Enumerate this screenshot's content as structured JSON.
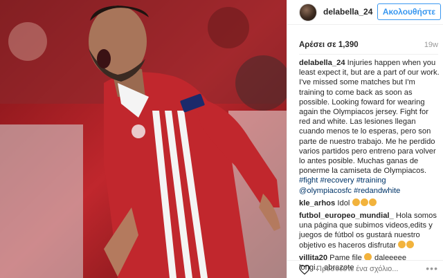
{
  "header": {
    "username": "delabella_24",
    "follow_label": "Ακολουθήστε"
  },
  "likes": "Αρέσει σε 1,390",
  "time": "19w",
  "caption": {
    "user": "delabella_24",
    "text": "Injuries happen when you least expect it, but are a part of our work. I've missed some matches but I'm training to come back as soon as possible. Looking foward for wearing again the Olympiacos jersey. Fight for red and white. Las lesiones llegan cuando menos te lo esperas, pero son parte de nuestro trabajo. Me he perdido varios partidos pero entreno para volver lo antes posible. Muchas ganas de ponerme la camiseta de Olympiacos.",
    "hashtags": "#fight #recovery #training",
    "mentions": "@olympiacosfc #redandwhite"
  },
  "comments": [
    {
      "user": "kle_arhos",
      "text": "Idol"
    },
    {
      "user": "futbol_europeo_mundial_",
      "text": "Hola somos una página que subimos videos,edits y juegos de fútbol os gustará nuestro objetivo es haceros disfrutar"
    },
    {
      "user": "villita20",
      "text": "Pame file",
      "text2": "daleeeee longi....abrazote"
    }
  ],
  "comment_placeholder": "Προσθέστε ένα σχόλιο...",
  "more_label": "•••",
  "icons": [
    "avatar",
    "heart-icon",
    "more-options-icon",
    "emoji"
  ],
  "colors": {
    "link": "#003569",
    "accent": "#3897f0",
    "jersey_red": "#c1272d"
  }
}
